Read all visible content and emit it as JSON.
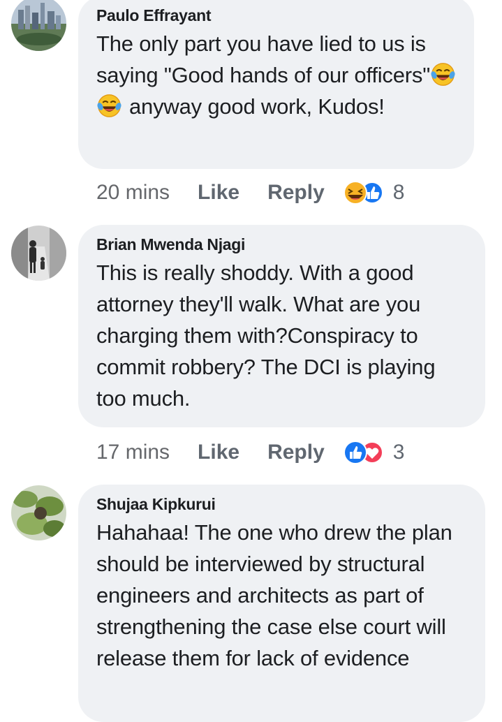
{
  "comments": [
    {
      "author": "Paulo Effrayant",
      "text_parts": [
        "The only part you have lied to us is saying \"Good hands of our officers\"",
        "anyway good work, Kudos!"
      ],
      "emoji": "laughing-tears",
      "time": "20 mins",
      "like_label": "Like",
      "reply_label": "Reply",
      "reactions": [
        "haha",
        "like"
      ],
      "reaction_count": "8"
    },
    {
      "author": "Brian Mwenda Njagi",
      "text": "This is really shoddy. With a good attorney they'll walk. What are you charging them with?Conspiracy to commit robbery? The DCI is playing too much.",
      "time": "17 mins",
      "like_label": "Like",
      "reply_label": "Reply",
      "reactions": [
        "like",
        "love"
      ],
      "reaction_count": "3"
    },
    {
      "author": "Shujaa Kipkurui",
      "text": "Hahahaa! The one who drew the plan should be interviewed by structural engineers and architects as part of strengthening the case else court will release them for lack of evidence"
    }
  ],
  "colors": {
    "bubble": "#eff1f4",
    "text": "#1c1e21",
    "meta": "#606770",
    "like_blue": "#1877f2",
    "love_red": "#f33e58",
    "haha_yellow": "#f7b125"
  }
}
